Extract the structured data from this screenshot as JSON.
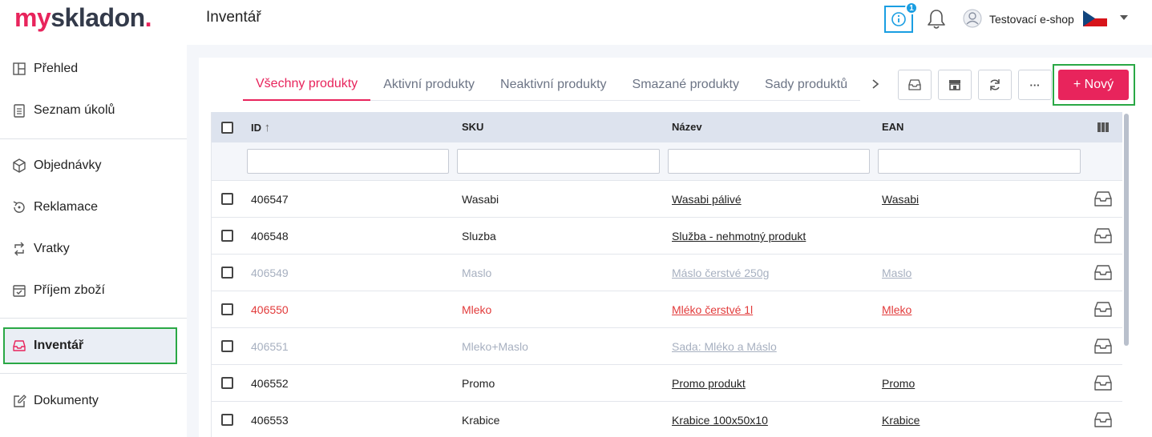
{
  "app": {
    "logo_my": "my",
    "logo_skladon": "skladon",
    "logo_dot": ".",
    "page_title": "Inventář"
  },
  "header": {
    "info_badge": "1",
    "user_name": "Testovací e-shop",
    "flag": "czech-flag-icon"
  },
  "sidebar": {
    "items": [
      {
        "label": "Přehled",
        "icon": "layout-icon"
      },
      {
        "label": "Seznam úkolů",
        "icon": "clipboard-icon"
      },
      {
        "label": "Objednávky",
        "icon": "box-icon"
      },
      {
        "label": "Reklamace",
        "icon": "refresh-return-icon"
      },
      {
        "label": "Vratky",
        "icon": "return-arrows-icon"
      },
      {
        "label": "Příjem zboží",
        "icon": "calendar-check-icon"
      },
      {
        "label": "Inventář",
        "icon": "inbox-icon"
      },
      {
        "label": "Dokumenty",
        "icon": "edit-document-icon"
      }
    ],
    "active_index": 6
  },
  "tabs": [
    {
      "label": "Všechny produkty",
      "active": true
    },
    {
      "label": "Aktivní produkty",
      "active": false
    },
    {
      "label": "Neaktivní produkty",
      "active": false
    },
    {
      "label": "Smazané produkty",
      "active": false
    },
    {
      "label": "Sady produktů",
      "active": false
    }
  ],
  "toolbar": {
    "more_label": "···",
    "new_label": "+ Nový"
  },
  "table": {
    "columns": [
      "ID",
      "SKU",
      "Název",
      "EAN"
    ],
    "sort_indicator": "↑",
    "rows": [
      {
        "id": "406547",
        "sku": "Wasabi",
        "name": "Wasabi pálivé",
        "ean": "Wasabi",
        "state": "normal"
      },
      {
        "id": "406548",
        "sku": "Sluzba",
        "name": "Služba - nehmotný produkt",
        "ean": "",
        "state": "normal"
      },
      {
        "id": "406549",
        "sku": "Maslo",
        "name": "Máslo čerstvé 250g",
        "ean": "Maslo",
        "state": "dim"
      },
      {
        "id": "406550",
        "sku": "Mleko",
        "name": "Mléko čerstvé 1l",
        "ean": "Mleko",
        "state": "red"
      },
      {
        "id": "406551",
        "sku": "Mleko+Maslo",
        "name": "Sada: Mléko a Máslo",
        "ean": "",
        "state": "dim"
      },
      {
        "id": "406552",
        "sku": "Promo",
        "name": "Promo produkt",
        "ean": "Promo",
        "state": "normal"
      },
      {
        "id": "406553",
        "sku": "Krabice",
        "name": "Krabice 100x50x10",
        "ean": "Krabice",
        "state": "normal"
      }
    ]
  },
  "colors": {
    "brand": "#e8245c",
    "accent_blue": "#1a9ee2",
    "highlight_green": "#2aa845",
    "dim_text": "#a7b0c0",
    "error_red": "#e23b3b"
  }
}
